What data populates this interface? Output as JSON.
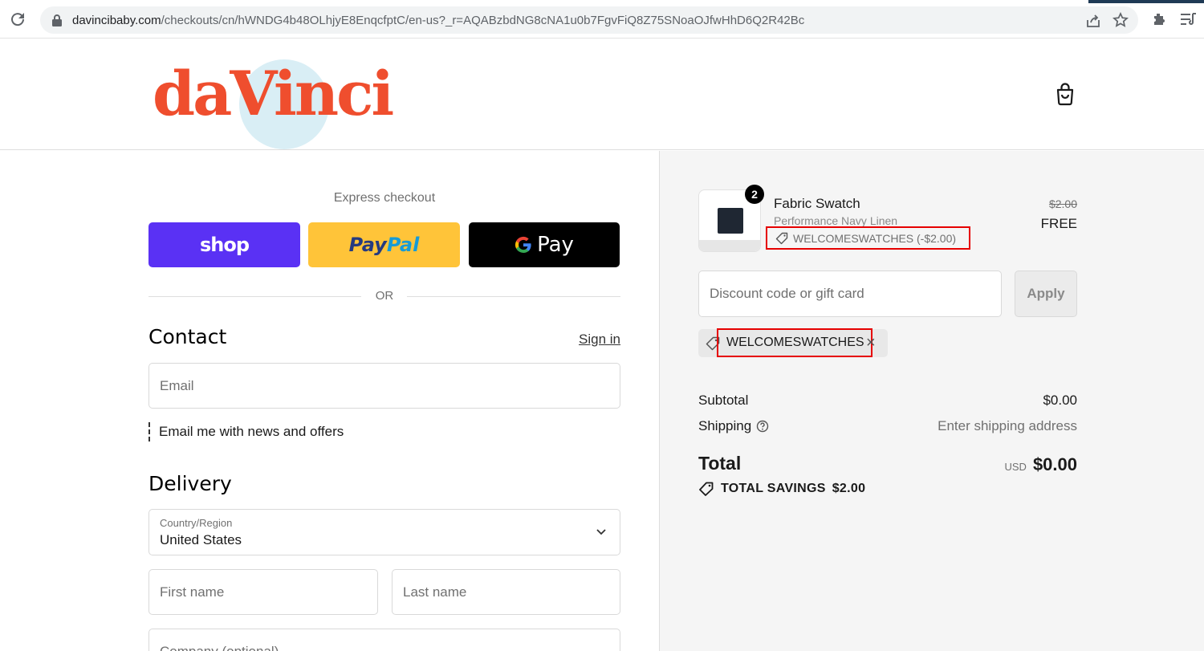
{
  "browser": {
    "url_domain": "davincibaby.com",
    "url_path": "/checkouts/cn/hWNDG4b48OLhjyE8EnqcfptC/en-us?_r=AQABzbdNG8cNA1u0b7FgvFiQ8Z75SNoaOJfwHhD6Q2R42Bc",
    "icons": [
      "reload-icon",
      "lock-icon",
      "share-icon",
      "star-icon",
      "extensions-icon",
      "reading-list-icon"
    ]
  },
  "header": {
    "logo_text": "daVinci",
    "brand_color": "#ef4e2e",
    "cart_icon": "shopping-bag-icon"
  },
  "express": {
    "title": "Express checkout",
    "shop_label": "shop",
    "paypal_label_1": "Pay",
    "paypal_label_2": "Pal",
    "gpay_g": "G",
    "gpay_label": "Pay",
    "colors": {
      "shop": "#5a31f4",
      "paypal": "#ffc439",
      "gpay": "#000000"
    }
  },
  "divider": {
    "or": "OR"
  },
  "contact": {
    "heading": "Contact",
    "signin": "Sign in",
    "email_placeholder": "Email",
    "newsletter_label": "Email me with news and offers"
  },
  "delivery": {
    "heading": "Delivery",
    "country_label": "Country/Region",
    "country_value": "United States",
    "first_name_placeholder": "First name",
    "last_name_placeholder": "Last name",
    "company_placeholder": "Company (optional)"
  },
  "summary": {
    "quantity": "2",
    "product_name": "Fabric Swatch",
    "product_variant": "Performance Navy Linen",
    "line_discount": "WELCOMESWATCHES (-$2.00)",
    "price_original": "$2.00",
    "price_current": "FREE",
    "discount_placeholder": "Discount code or gift card",
    "apply_label": "Apply",
    "applied_code": "WELCOMESWATCHES",
    "remove_glyph": "×",
    "subtotal_label": "Subtotal",
    "subtotal_value": "$0.00",
    "shipping_label": "Shipping",
    "shipping_value": "Enter shipping address",
    "total_label": "Total",
    "total_currency": "USD",
    "total_value": "$0.00",
    "savings_label": "TOTAL SAVINGS",
    "savings_value": "$2.00",
    "highlight_color": "#e60000"
  }
}
